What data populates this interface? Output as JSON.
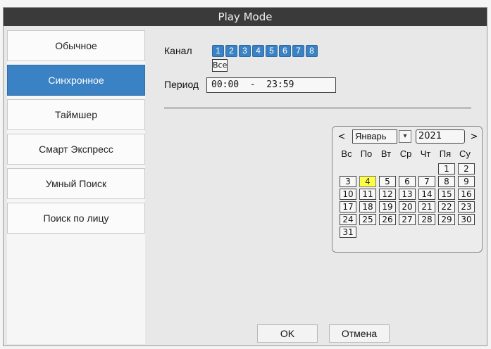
{
  "window": {
    "title": "Play Mode"
  },
  "sidebar": {
    "items": [
      {
        "label": "Обычное"
      },
      {
        "label": "Синхронное"
      },
      {
        "label": "Таймшер"
      },
      {
        "label": "Смарт Экспресс"
      },
      {
        "label": "Умный Поиск"
      },
      {
        "label": "Поиск по лицу"
      }
    ],
    "selected_index": 1
  },
  "channel": {
    "label": "Канал",
    "channels": [
      "1",
      "2",
      "3",
      "4",
      "5",
      "6",
      "7",
      "8"
    ],
    "all_label": "Bce"
  },
  "period": {
    "label": "Период",
    "value": "00:00  -  23:59"
  },
  "calendar": {
    "prev": "<",
    "next": ">",
    "month": "Январь",
    "year": "2021",
    "weekdays": [
      "Вс",
      "По",
      "Вт",
      "Ср",
      "Чт",
      "Пя",
      "Су"
    ],
    "weeks": [
      [
        "",
        "",
        "",
        "",
        "",
        "1",
        "2"
      ],
      [
        "3",
        "4",
        "5",
        "6",
        "7",
        "8",
        "9"
      ],
      [
        "10",
        "11",
        "12",
        "13",
        "14",
        "15",
        "16"
      ],
      [
        "17",
        "18",
        "19",
        "20",
        "21",
        "22",
        "23"
      ],
      [
        "24",
        "25",
        "26",
        "27",
        "28",
        "29",
        "30"
      ],
      [
        "31",
        "",
        "",
        "",
        "",
        "",
        ""
      ]
    ],
    "selected_day": "4"
  },
  "buttons": {
    "ok": "OK",
    "cancel": "Отмена"
  },
  "colors": {
    "accent": "#3a82c4",
    "title_bar": "#3a3a3a",
    "today": "#ffff44"
  }
}
